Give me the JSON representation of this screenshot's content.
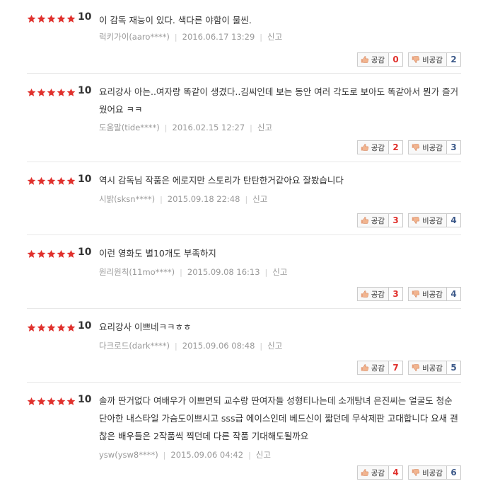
{
  "reviews": [
    {
      "score": "10",
      "text": "이 감독 재능이 있다. 색다른 야함이 물씬.",
      "author": "럭키가이(aaro****)",
      "date": "2016.06.17 13:29",
      "up": "0",
      "down": "2"
    },
    {
      "score": "10",
      "text": "요리강사 아는..여자랑 똑같이 생겼다..김씨인데 보는 동안 여러 각도로 보아도 똑같아서 뭔가 즐거웠어요 ㅋㅋ",
      "author": "도움말(tide****)",
      "date": "2016.02.15 12:27",
      "up": "2",
      "down": "3"
    },
    {
      "score": "10",
      "text": "역시 감독님 작품은 에로지만 스토리가 탄탄한거같아요 잘봤습니다",
      "author": "시밝(sksn****)",
      "date": "2015.09.18 22:48",
      "up": "3",
      "down": "4"
    },
    {
      "score": "10",
      "text": "이런 영화도 별10개도 부족하지",
      "author": "원리원칙(11mo****)",
      "date": "2015.09.08 16:13",
      "up": "3",
      "down": "4"
    },
    {
      "score": "10",
      "text": "요리강사 이쁘네ㅋㅋㅎㅎ",
      "author": "다크로드(dark****)",
      "date": "2015.09.06 08:48",
      "up": "7",
      "down": "5"
    },
    {
      "score": "10",
      "text": "솔까 딴거없다 여배우가 이쁘면되 교수랑 딴여자들 성형티나는데 소개탕녀 은진씨는 얼굴도 청순 단아한 내스타일 가슴도이쁘시고 sss급 에이스인데 베드신이 짧던데 무삭제판 고대합니다 요새 괜찮은 배우들은 2작품씩 찍던데 다른 작품 기대해도될까요",
      "author": "ysw(ysw8****)",
      "date": "2015.09.06 04:42",
      "up": "4",
      "down": "6"
    }
  ],
  "labels": {
    "report": "신고",
    "like": "공감",
    "dislike": "비공감"
  },
  "icons": {
    "star": "star-icon",
    "like": "thumbs-up-icon",
    "dislike": "thumbs-down-icon"
  },
  "colors": {
    "star": "#e0312d",
    "up": "#e0312d",
    "down": "#3d5a8a"
  }
}
